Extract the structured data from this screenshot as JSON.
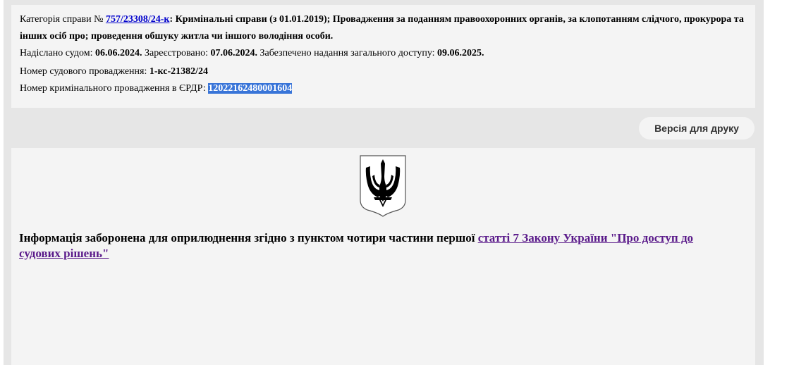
{
  "case_info": {
    "category_prefix": "Категорія справи № ",
    "case_number": "757/23308/24-к",
    "category_text": ": Кримінальні справи (з 01.01.2019); Провадження за поданням правоохоронних органів, за клопотанням слідчого, прокурора та інших осіб про; проведення обшуку житла чи іншого володіння особи.",
    "sent_label": "Надіслано судом: ",
    "sent_date": "06.06.2024.",
    "registered_label": " Зареєстровано: ",
    "registered_date": "07.06.2024.",
    "access_label": " Забезпечено надання загального доступу: ",
    "access_date": "09.06.2025.",
    "court_proceeding_label": "Номер судового провадження: ",
    "court_proceeding_number": "1-кс-21382/24",
    "erdr_label": "Номер кримінального провадження в ЄРДР: ",
    "erdr_number": "12022162480001604"
  },
  "toolbar": {
    "print_label": "Версія для друку"
  },
  "document": {
    "emblem_icon": "coat-of-arms-of-ukraine-icon",
    "notice_text": "Інформація заборонена для оприлюднення згідно з пунктом чотири частини першої ",
    "notice_link": "статті 7 Закону України \"Про доступ до судових рішень\""
  },
  "colors": {
    "link": "#0000cc",
    "visited_link": "#5a1a8a",
    "selection": "#3874d8",
    "panel": "#f4f4f4",
    "frame": "#e6e6e6"
  }
}
